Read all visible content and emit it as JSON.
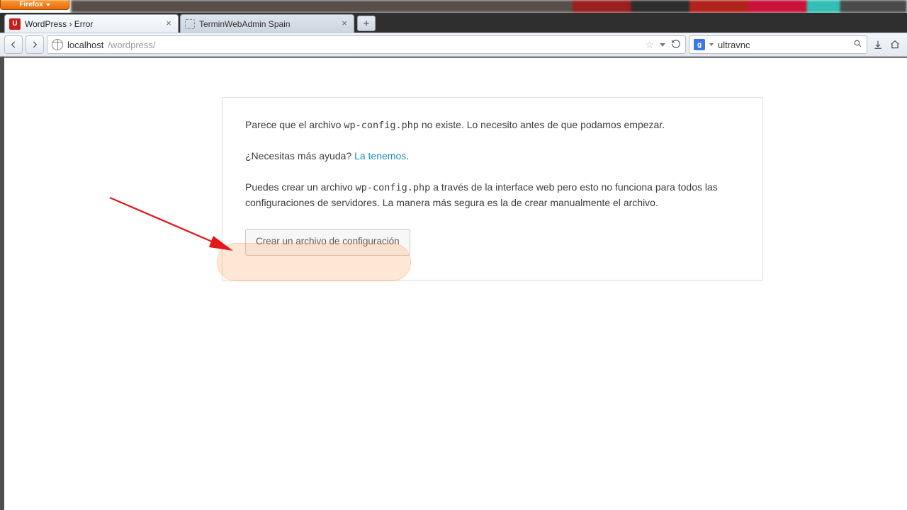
{
  "firefox": {
    "label": "Firefox"
  },
  "tabs": [
    {
      "title": "WordPress › Error",
      "favicon": "u",
      "active": true
    },
    {
      "title": "TerminWebAdmin Spain",
      "favicon": "dash",
      "active": false
    }
  ],
  "url": {
    "host": "localhost",
    "path": "/wordpress/"
  },
  "search": {
    "value": "ultravnc"
  },
  "wp": {
    "p1a": "Parece que el archivo ",
    "p1code": "wp-config.php",
    "p1b": " no existe. Lo necesito antes de que podamos empezar.",
    "p2a": "¿Necesitas más ayuda? ",
    "p2link": "La tenemos",
    "p2b": ".",
    "p3a": "Puedes crear un archivo ",
    "p3code": "wp-config.php",
    "p3b": " a través de la interface web pero esto no funciona para todos las configuraciones de servidores. La manera más segura es la de crear manualmente el archivo.",
    "button": "Crear un archivo de configuración"
  }
}
